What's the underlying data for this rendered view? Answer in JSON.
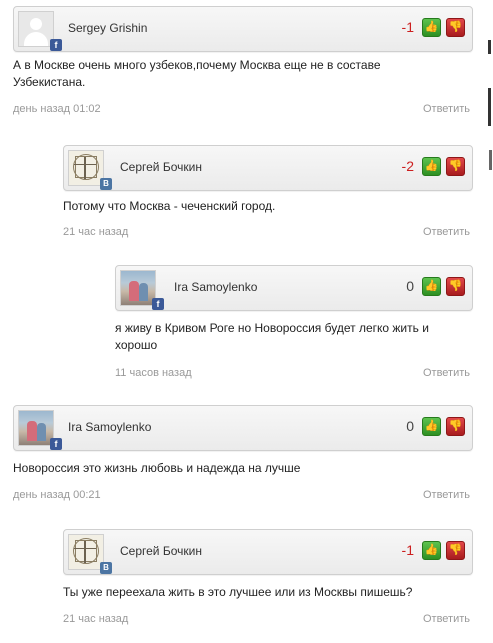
{
  "comments": [
    {
      "author": "Sergey Grishin",
      "network": "f",
      "avatar": "default-user-avatar",
      "rating": "-1",
      "text": "А в Москве очень много узбеков,почему Москва еще не в составе Узбекистана.",
      "time": "день назад 01:02",
      "reply_label": "Ответить"
    },
    {
      "author": "Сергей Бочкин",
      "network": "B",
      "avatar": "sketch-avatar",
      "rating": "-2",
      "text": "Потому что Москва - чеченский город.",
      "time": "21 час назад",
      "reply_label": "Ответить"
    },
    {
      "author": "Ira Samoylenko",
      "network": "f",
      "avatar": "photo-avatar",
      "rating": "0",
      "text": "я живу в Кривом Роге но Новороссия будет легко жить и хорошо",
      "time": "11 часов назад",
      "reply_label": "Ответить"
    },
    {
      "author": "Ira Samoylenko",
      "network": "f",
      "avatar": "photo-avatar",
      "rating": "0",
      "text": "Новороссия это жизнь любовь и надежда на лучше",
      "time": "день назад 00:21",
      "reply_label": "Ответить"
    },
    {
      "author": "Сергей Бочкин",
      "network": "B",
      "avatar": "sketch-avatar",
      "rating": "-1",
      "text": "Ты уже переехала жить в это лучшее или из Москвы пишешь?",
      "time": "21 час назад",
      "reply_label": "Ответить"
    }
  ],
  "icons": {
    "vote_up": "thumbs-up-icon",
    "vote_down": "thumbs-down-icon"
  },
  "colors": {
    "negative_rating": "#cc1f1f",
    "vote_up": "#3fa832",
    "vote_down": "#c42a2c",
    "facebook": "#3b5998",
    "vkontakte": "#4c75a3"
  }
}
